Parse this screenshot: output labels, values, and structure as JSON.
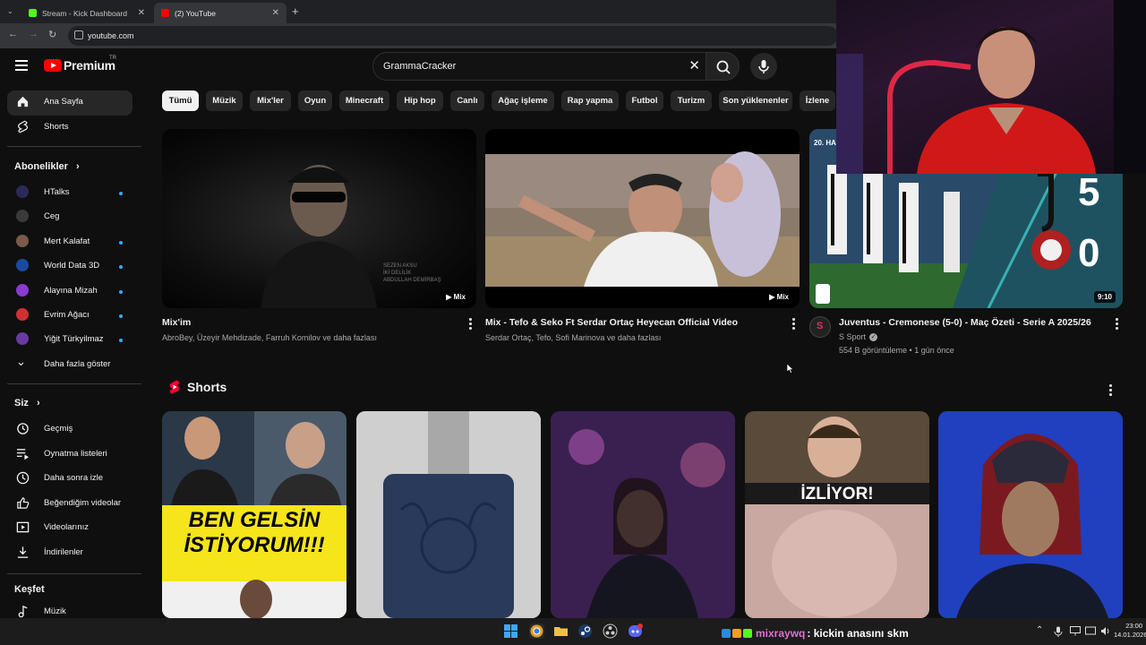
{
  "browser": {
    "tabs": [
      {
        "title": "Stream - Kick Dashboard",
        "active": false,
        "color": "#53fc18"
      },
      {
        "title": "(2) YouTube",
        "active": true,
        "color": "#ff0000"
      }
    ],
    "address": "youtube.com"
  },
  "header": {
    "logo_text": "Premium",
    "country_code": "TR",
    "search_value": "GrammaCracker"
  },
  "chips": [
    "Tümü",
    "Müzik",
    "Mix'ler",
    "Oyun",
    "Minecraft",
    "Hip hop",
    "Canlı",
    "Ağaç işleme",
    "Rap yapma",
    "Futbol",
    "Turizm",
    "Son yüklenenler",
    "İzlene"
  ],
  "sidebar": {
    "main": [
      {
        "label": "Ana Sayfa",
        "icon": "home-icon"
      },
      {
        "label": "Shorts",
        "icon": "shorts-icon"
      }
    ],
    "subscriptions_title": "Abonelikler",
    "subscriptions": [
      {
        "label": "HTalks",
        "dot": true,
        "color": "#2a2a5a"
      },
      {
        "label": "Ceg",
        "dot": false,
        "color": "#3a3a3a"
      },
      {
        "label": "Mert Kalafat",
        "dot": true,
        "color": "#7a5a4a"
      },
      {
        "label": "World Data 3D",
        "dot": true,
        "color": "#1a4aa0"
      },
      {
        "label": "Alayına Mizah",
        "dot": true,
        "color": "#8a3ad0"
      },
      {
        "label": "Evrim Ağacı",
        "dot": true,
        "color": "#d03030"
      },
      {
        "label": "Yiğit Türkyilmaz",
        "dot": true,
        "color": "#6a3aa0"
      }
    ],
    "show_more": "Daha fazla göster",
    "you_title": "Siz",
    "you": [
      {
        "label": "Geçmiş",
        "icon": "history-icon"
      },
      {
        "label": "Oynatma listeleri",
        "icon": "playlists-icon"
      },
      {
        "label": "Daha sonra izle",
        "icon": "watch-later-icon"
      },
      {
        "label": "Beğendiğim videolar",
        "icon": "liked-videos-icon"
      },
      {
        "label": "Videolarınız",
        "icon": "your-videos-icon"
      },
      {
        "label": "İndirilenler",
        "icon": "downloads-icon"
      }
    ],
    "explore_title": "Keşfet",
    "explore": [
      {
        "label": "Müzik",
        "icon": "music-icon"
      }
    ]
  },
  "videos": [
    {
      "title": "Mix'im",
      "channel": "AbroBey, Üzeyir Mehdizade, Farruh Komilov ve daha fazlası",
      "badge": "Mix",
      "overlay": "SEZEN AKSU\nİKİ DELİLİK\nABDULLAH DEMİRBAŞ"
    },
    {
      "title": "Mix - Tefo & Seko Ft  Serdar Ortaç   Heyecan Official Video",
      "channel": "Serdar Ortaç, Tefo, Sofi Marinova ve daha fazlası",
      "badge": "Mix"
    },
    {
      "title": "Juventus - Cremonese (5-0) - Maç Özeti - Serie A 2025/26",
      "channel": "S Sport",
      "stats": "554 B görüntüleme • 1 gün önce",
      "duration": "9:10",
      "corner_text": "20. HA",
      "score_home": "5",
      "score_away": "0"
    }
  ],
  "shorts_title": "Shorts",
  "shorts": [
    {
      "caption": "BEN GELSİN\nİSTİYORUM!!!"
    },
    {
      "caption": ""
    },
    {
      "caption": ""
    },
    {
      "caption": "İZLİYOR!"
    },
    {
      "caption": ""
    }
  ],
  "taskbar": {
    "chat_user": "mixraywq",
    "chat_message": ": kickin anasını skm",
    "time": "23:00",
    "date": "14.01.2026"
  }
}
